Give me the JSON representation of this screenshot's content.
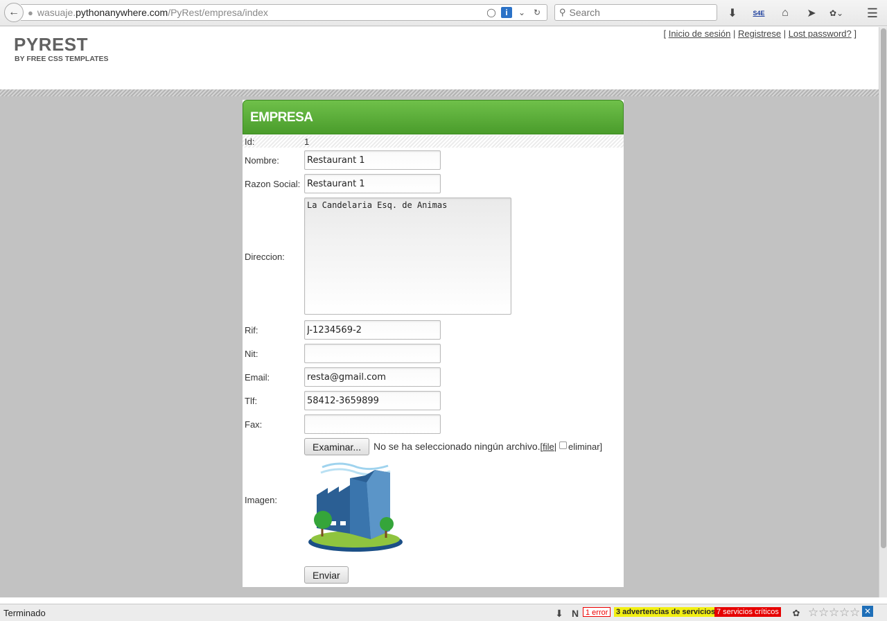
{
  "browser": {
    "url_prefix": "wasuaje.",
    "url_host": "pythonanywhere.com",
    "url_path": "/PyRest/empresa/index",
    "search_placeholder": "Search"
  },
  "site": {
    "title": "PYREST",
    "subtitle": "BY FREE CSS TEMPLATES",
    "links": {
      "open": "[ ",
      "login": "Inicio de sesión",
      "sep1": " | ",
      "register": "Registrese",
      "sep2": " | ",
      "lost": "Lost password?",
      "close": " ]"
    }
  },
  "panel": {
    "title": "EMPRESA"
  },
  "form": {
    "id": {
      "label": "Id:",
      "value": "1"
    },
    "nombre": {
      "label": "Nombre:",
      "value": "Restaurant 1"
    },
    "razon": {
      "label": "Razon Social:",
      "value": "Restaurant 1"
    },
    "direccion": {
      "label": "Direccion:",
      "value": "La Candelaria Esq. de Animas"
    },
    "rif": {
      "label": "Rif:",
      "value": "J-1234569-2"
    },
    "nit": {
      "label": "Nit:",
      "value": ""
    },
    "email": {
      "label": "Email:",
      "value": "resta@gmail.com"
    },
    "tlf": {
      "label": "Tlf:",
      "value": "58412-3659899"
    },
    "fax": {
      "label": "Fax:",
      "value": ""
    },
    "file": {
      "button": "Examinar...",
      "status": "No se ha seleccionado ningún archivo.",
      "bracket_open": "[",
      "file_link": "file",
      "pipe": "|",
      "delete": "eliminar",
      "bracket_close": "]"
    },
    "imagen": {
      "label": "Imagen:"
    },
    "submit": "Enviar"
  },
  "statusbar": {
    "text": "Terminado",
    "error": "1 error",
    "warnings": "3 advertencias de servicios",
    "critical": "7 servicios críticos"
  },
  "icons": [
    "back-arrow-icon",
    "globe-icon",
    "shield-icon",
    "info-icon",
    "reload-icon",
    "search-icon",
    "download-icon",
    "home-icon",
    "send-icon",
    "menu-icon",
    "star-icon"
  ]
}
